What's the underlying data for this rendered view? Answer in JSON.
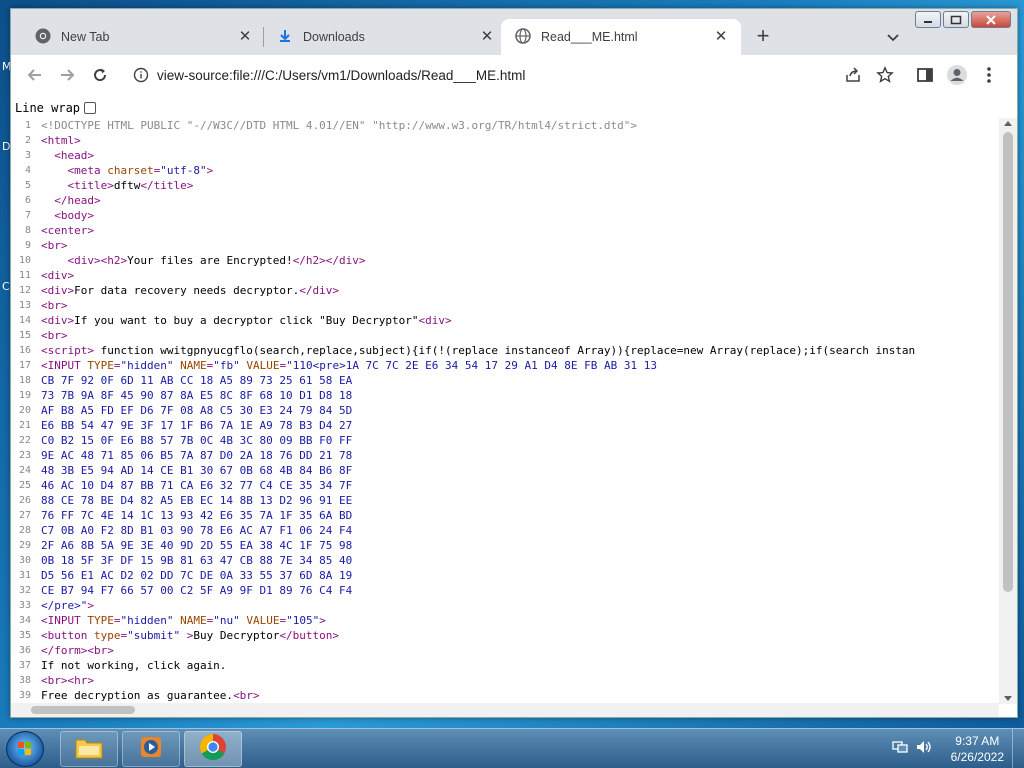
{
  "browser": {
    "tabs": [
      {
        "label": "New Tab",
        "icon": "chrome-icon",
        "active": false
      },
      {
        "label": "Downloads",
        "icon": "download-icon",
        "active": false
      },
      {
        "label": "Read___ME.html",
        "icon": "globe-icon",
        "active": true
      }
    ],
    "new_tab_symbol": "+",
    "url": "view-source:file:///C:/Users/vm1/Downloads/Read___ME.html"
  },
  "viewer": {
    "line_wrap_label": "Line wrap",
    "line_wrap_checked": false,
    "lines": [
      {
        "n": "1",
        "html": "<span class='cmt'>&lt;!DOCTYPE HTML PUBLIC \"-//W3C//DTD HTML 4.01//EN\" \"http://www.w3.org/TR/html4/strict.dtd\"&gt;</span>"
      },
      {
        "n": "2",
        "html": "<span class='tag'>&lt;html&gt;</span>"
      },
      {
        "n": "3",
        "html": "  <span class='tag'>&lt;head&gt;</span>"
      },
      {
        "n": "4",
        "html": "    <span class='tag'>&lt;meta </span><span class='attr'>charset</span><span class='tag'>=</span><span class='val'>\"utf-8\"</span><span class='tag'>&gt;</span>"
      },
      {
        "n": "5",
        "html": "    <span class='tag'>&lt;title&gt;</span>dftw<span class='tag'>&lt;/title&gt;</span>"
      },
      {
        "n": "6",
        "html": "  <span class='tag'>&lt;/head&gt;</span>"
      },
      {
        "n": "7",
        "html": "  <span class='tag'>&lt;body&gt;</span>"
      },
      {
        "n": "8",
        "html": "<span class='tag'>&lt;center&gt;</span>"
      },
      {
        "n": "9",
        "html": "<span class='tag'>&lt;br&gt;</span>"
      },
      {
        "n": "10",
        "html": "    <span class='tag'>&lt;div&gt;&lt;h2&gt;</span>Your files are Encrypted!<span class='tag'>&lt;/h2&gt;&lt;/div&gt;</span>"
      },
      {
        "n": "11",
        "html": "<span class='tag'>&lt;div&gt;</span>"
      },
      {
        "n": "12",
        "html": "<span class='tag'>&lt;div&gt;</span>For data recovery needs decryptor.<span class='tag'>&lt;/div&gt;</span>"
      },
      {
        "n": "13",
        "html": "<span class='tag'>&lt;br&gt;</span>"
      },
      {
        "n": "14",
        "html": "<span class='tag'>&lt;div&gt;</span>If you want to buy a decryptor click \"Buy Decryptor\"<span class='tag'>&lt;div&gt;</span>"
      },
      {
        "n": "15",
        "html": "<span class='tag'>&lt;br&gt;</span>"
      },
      {
        "n": "16",
        "html": "<span class='tag'>&lt;script&gt;</span> function wwitgpnyucgflo(search,replace,subject){if(!(replace instanceof Array)){replace=new Array(replace);if(search instan"
      },
      {
        "n": "17",
        "html": "<span class='tag'>&lt;INPUT </span><span class='attr'>TYPE</span><span class='tag'>=</span><span class='val'>\"hidden\"</span><span class='tag'> </span><span class='attr'>NAME</span><span class='tag'>=</span><span class='val'>\"fb\"</span><span class='tag'> </span><span class='attr'>VALUE</span><span class='tag'>=</span><span class='val'>\"110&lt;pre&gt;1A 7C 7C 2E E6 34 54 17 29 A1 D4 8E FB AB 31 13</span>"
      },
      {
        "n": "18",
        "html": "<span class='val'>CB 7F 92 0F 6D 11 AB CC 18 A5 89 73 25 61 58 EA</span>"
      },
      {
        "n": "19",
        "html": "<span class='val'>73 7B 9A 8F 45 90 87 8A E5 8C 8F 68 10 D1 D8 18</span>"
      },
      {
        "n": "20",
        "html": "<span class='val'>AF B8 A5 FD EF D6 7F 08 A8 C5 30 E3 24 79 84 5D</span>"
      },
      {
        "n": "21",
        "html": "<span class='val'>E6 BB 54 47 9E 3F 17 1F B6 7A 1E A9 78 B3 D4 27</span>"
      },
      {
        "n": "22",
        "html": "<span class='val'>C0 B2 15 0F E6 B8 57 7B 0C 4B 3C 80 09 BB F0 FF</span>"
      },
      {
        "n": "23",
        "html": "<span class='val'>9E AC 48 71 85 06 B5 7A 87 D0 2A 18 76 DD 21 78</span>"
      },
      {
        "n": "24",
        "html": "<span class='val'>48 3B E5 94 AD 14 CE B1 30 67 0B 68 4B 84 B6 8F</span>"
      },
      {
        "n": "25",
        "html": "<span class='val'>46 AC 10 D4 87 BB 71 CA E6 32 77 C4 CE 35 34 7F</span>"
      },
      {
        "n": "26",
        "html": "<span class='val'>88 CE 78 BE D4 82 A5 EB EC 14 8B 13 D2 96 91 EE</span>"
      },
      {
        "n": "27",
        "html": "<span class='val'>76 FF 7C 4E 14 1C 13 93 42 E6 35 7A 1F 35 6A BD</span>"
      },
      {
        "n": "28",
        "html": "<span class='val'>C7 0B A0 F2 8D B1 03 90 78 E6 AC A7 F1 06 24 F4</span>"
      },
      {
        "n": "29",
        "html": "<span class='val'>2F A6 8B 5A 9E 3E 40 9D 2D 55 EA 38 4C 1F 75 98</span>"
      },
      {
        "n": "30",
        "html": "<span class='val'>0B 18 5F 3F DF 15 9B 81 63 47 CB 88 7E 34 85 40</span>"
      },
      {
        "n": "31",
        "html": "<span class='val'>D5 56 E1 AC D2 02 DD 7C DE 0A 33 55 37 6D 8A 19</span>"
      },
      {
        "n": "32",
        "html": "<span class='val'>CE B7 94 F7 66 57 00 C2 5F A9 9F D1 89 76 C4 F4</span>"
      },
      {
        "n": "33",
        "html": "<span class='val'>&lt;/pre&gt;\"</span><span class='tag'>&gt;</span>"
      },
      {
        "n": "34",
        "html": "<span class='tag'>&lt;INPUT </span><span class='attr'>TYPE</span><span class='tag'>=</span><span class='val'>\"hidden\"</span><span class='tag'> </span><span class='attr'>NAME</span><span class='tag'>=</span><span class='val'>\"nu\"</span><span class='tag'> </span><span class='attr'>VALUE</span><span class='tag'>=</span><span class='val'>\"105\"</span><span class='tag'>&gt;</span>"
      },
      {
        "n": "35",
        "html": "<span class='tag'>&lt;button </span><span class='attr'>type</span><span class='tag'>=</span><span class='val'>\"submit\"</span><span class='tag'> &gt;</span>Buy Decryptor<span class='tag'>&lt;/button&gt;</span>"
      },
      {
        "n": "36",
        "html": "<span class='tag'>&lt;/form&gt;&lt;br&gt;</span>"
      },
      {
        "n": "37",
        "html": "If not working, click again."
      },
      {
        "n": "38",
        "html": "<span class='tag'>&lt;br&gt;&lt;hr&gt;</span>"
      },
      {
        "n": "39",
        "html": "Free decryption as guarantee.<span class='tag'>&lt;br&gt;</span>"
      }
    ]
  },
  "taskbar": {
    "time": "9:37 AM",
    "date": "6/26/2022",
    "items": [
      "windows-explorer",
      "media-player",
      "chrome"
    ]
  },
  "colors": {
    "tag": "#881280",
    "attr": "#994500",
    "value": "#1a1aa6",
    "comment": "#8a8a8a"
  }
}
